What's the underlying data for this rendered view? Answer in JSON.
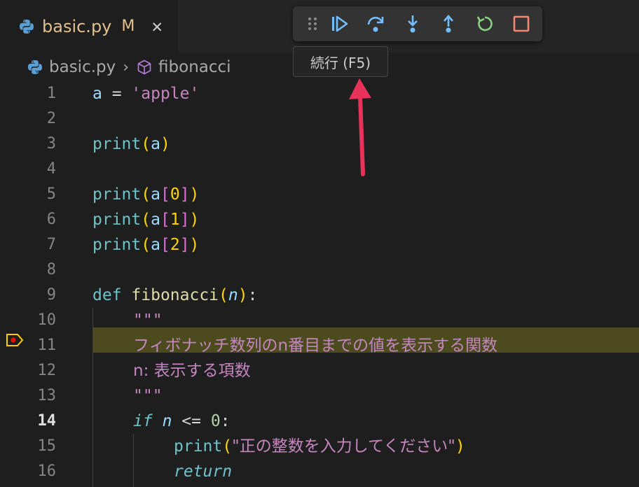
{
  "tab": {
    "filename": "basic.py",
    "modified_badge": "M",
    "close_glyph": "✕"
  },
  "breadcrumb": {
    "file": "basic.py",
    "separator": "›",
    "symbol": "fibonacci"
  },
  "debug_toolbar": {
    "buttons": [
      {
        "name": "drag-handle-icon",
        "glyph": "⠿"
      },
      {
        "name": "continue-icon"
      },
      {
        "name": "step-over-icon"
      },
      {
        "name": "step-into-icon"
      },
      {
        "name": "step-out-icon"
      },
      {
        "name": "restart-icon"
      },
      {
        "name": "stop-icon"
      }
    ],
    "tooltip": "続行 (F5)"
  },
  "colors": {
    "continue": "#75beff",
    "step": "#75beff",
    "restart": "#89d185",
    "stop": "#f48771",
    "annotation_arrow": "#e8325a",
    "current_line": "#4b4b1e"
  },
  "editor": {
    "current_line": 14,
    "line_numbers": [
      "1",
      "2",
      "3",
      "4",
      "5",
      "6",
      "7",
      "8",
      "9",
      "10",
      "11",
      "12",
      "13",
      "14",
      "15",
      "16"
    ],
    "code": {
      "l1_var": "a",
      "l1_eq": " = ",
      "l1_str": "'apple'",
      "print": "print",
      "l3_arg": "a",
      "l5_idx": "0",
      "l6_idx": "1",
      "l7_idx": "2",
      "def": "def",
      "fn_name": "fibonacci",
      "param": "n",
      "docquote": "\"\"\"",
      "doc1": "フィボナッチ数列のn番目までの値を表示する関数",
      "doc2": "n: 表示する項数",
      "if": "if",
      "cond_var": "n",
      "cond_op": " <= ",
      "cond_num": "0",
      "msg": "\"正の整数を入力してください\"",
      "return": "return"
    }
  }
}
